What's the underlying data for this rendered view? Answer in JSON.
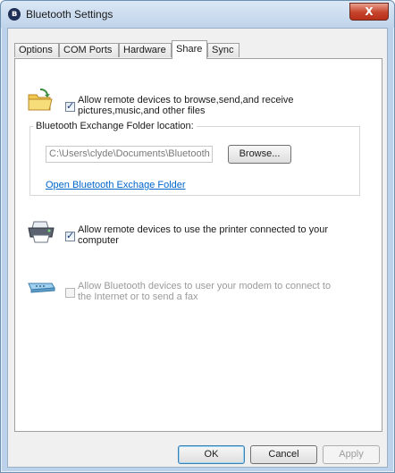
{
  "window": {
    "title": "Bluetooth Settings",
    "close_glyph": "X"
  },
  "tabs": [
    {
      "label": "Options"
    },
    {
      "label": "COM Ports"
    },
    {
      "label": "Hardware"
    },
    {
      "label": "Share"
    },
    {
      "label": "Sync"
    }
  ],
  "share": {
    "file_sharing": {
      "checked": true,
      "label_line1": "Allow remote devices to browse,send,and receive",
      "label_line2": "pictures,music,and other files"
    },
    "exchange_folder": {
      "group_label": "Bluetooth Exchange Folder location:",
      "path_value": "C:\\Users\\clyde\\Documents\\Bluetooth Fol",
      "browse_label": "Browse...",
      "open_link": "Open Bluetooth Exchage Folder"
    },
    "printer": {
      "checked": true,
      "label_line1": "Allow remote devices to use the printer connected to your",
      "label_line2": "computer"
    },
    "modem": {
      "checked": false,
      "disabled": true,
      "label_line1": "Allow Bluetooth devices to user your modem to connect to",
      "label_line2": "the Internet or to send a fax"
    }
  },
  "footer": {
    "ok": "OK",
    "cancel": "Cancel",
    "apply": "Apply"
  }
}
